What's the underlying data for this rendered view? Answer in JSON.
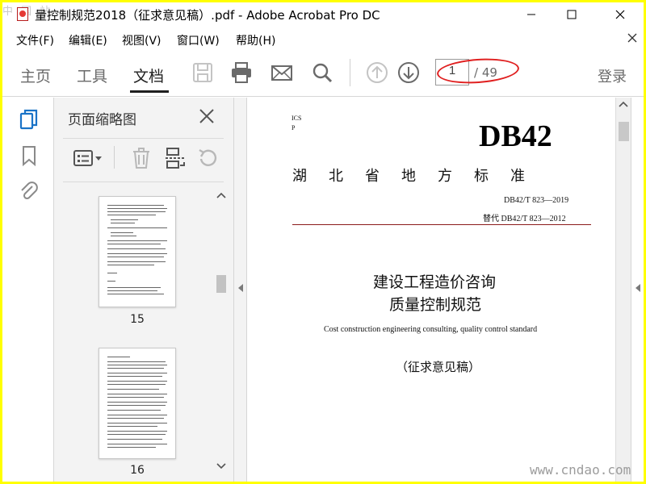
{
  "window": {
    "title": "量控制规范2018（征求意见稿）.pdf - Adobe Acrobat Pro DC",
    "watermark_top": "中 国 站",
    "watermark_bottom": "www.cndao.com"
  },
  "menu": {
    "items": [
      "文件(F)",
      "编辑(E)",
      "视图(V)",
      "窗口(W)",
      "帮助(H)"
    ]
  },
  "toolbar": {
    "tabs": [
      "主页",
      "工具",
      "文档"
    ],
    "active_tab": "文档",
    "icons": [
      "save-icon",
      "print-icon",
      "email-icon",
      "search-icon",
      "page-up-icon",
      "page-down-icon"
    ],
    "page_current": "1",
    "page_total": "/ 49",
    "login_label": "登录",
    "annotation_color": "#e02020"
  },
  "panel": {
    "title": "页面缩略图",
    "thumbnails": [
      {
        "label": "15"
      },
      {
        "label": "16"
      }
    ]
  },
  "document": {
    "ics": "ICS",
    "p": "P",
    "db": "DB42",
    "standard_name": "湖北省地方标准",
    "number": "DB42/T  823—2019",
    "replaces": "替代  DB42/T 823—2012",
    "title_line1": "建设工程造价咨询",
    "title_line2": "质量控制规范",
    "english_title": "Cost construction engineering consulting, quality control standard",
    "draft_label": "（征求意见稿）"
  },
  "colors": {
    "frame": "#ffff00",
    "rule": "#8b1a1a"
  }
}
